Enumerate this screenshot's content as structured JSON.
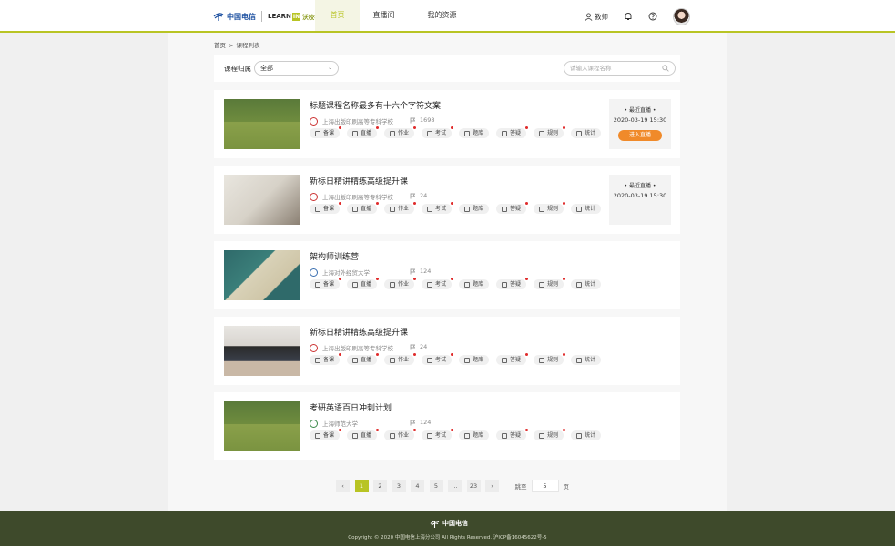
{
  "header": {
    "brand_cn": "中国电信",
    "learn_prefix": "LEARN",
    "learn_box": "IN",
    "learn_cn": "沃校学",
    "nav": [
      {
        "label": "首页",
        "active": true
      },
      {
        "label": "直播间",
        "active": false
      },
      {
        "label": "我的资源",
        "active": false
      }
    ],
    "role": "教师"
  },
  "breadcrumb": {
    "home": "首页",
    "sep": ">",
    "current": "课程列表"
  },
  "filter": {
    "label": "课程归属",
    "selected": "全部",
    "search_placeholder": "请输入课程名称"
  },
  "tool_labels": [
    "备课",
    "直播",
    "作业",
    "考试",
    "题库",
    "答疑",
    "规则",
    "统计"
  ],
  "courses": [
    {
      "title": "标题课程名称最多有十六个字符文案",
      "school": "上海出版印刷高等专科学校",
      "count": "1698",
      "live": {
        "label": "最近直播",
        "time": "2020-03-19  15:30",
        "button": "进入直播"
      }
    },
    {
      "title": "新标日精讲精练高级提升课",
      "school": "上海出版印刷高等专科学校",
      "count": "24",
      "live": {
        "label": "最近直播",
        "time": "2020-03-19  15:30"
      }
    },
    {
      "title": "架构师训练营",
      "school": "上海对外经贸大学",
      "count": "124"
    },
    {
      "title": "新标日精讲精练高级提升课",
      "school": "上海出版印刷高等专科学校",
      "count": "24"
    },
    {
      "title": "考研英语百日冲刺计划",
      "school": "上海师范大学",
      "count": "124"
    }
  ],
  "pagination": {
    "prev": "‹",
    "next": "›",
    "pages": [
      "1",
      "2",
      "3",
      "4",
      "5",
      "...",
      "23"
    ],
    "current": "1",
    "jump_label": "跳至",
    "jump_value": "5",
    "jump_suffix": "页"
  },
  "footer": {
    "brand_cn": "中国电信",
    "copyright": "Copyright © 2020 中国电信上海分公司 All Rights Reserved. 沪ICP备16045622号-5"
  },
  "colors": {
    "accent": "#b8c424",
    "live_button": "#f08a2a",
    "footer_bg": "#3e4a2b"
  }
}
